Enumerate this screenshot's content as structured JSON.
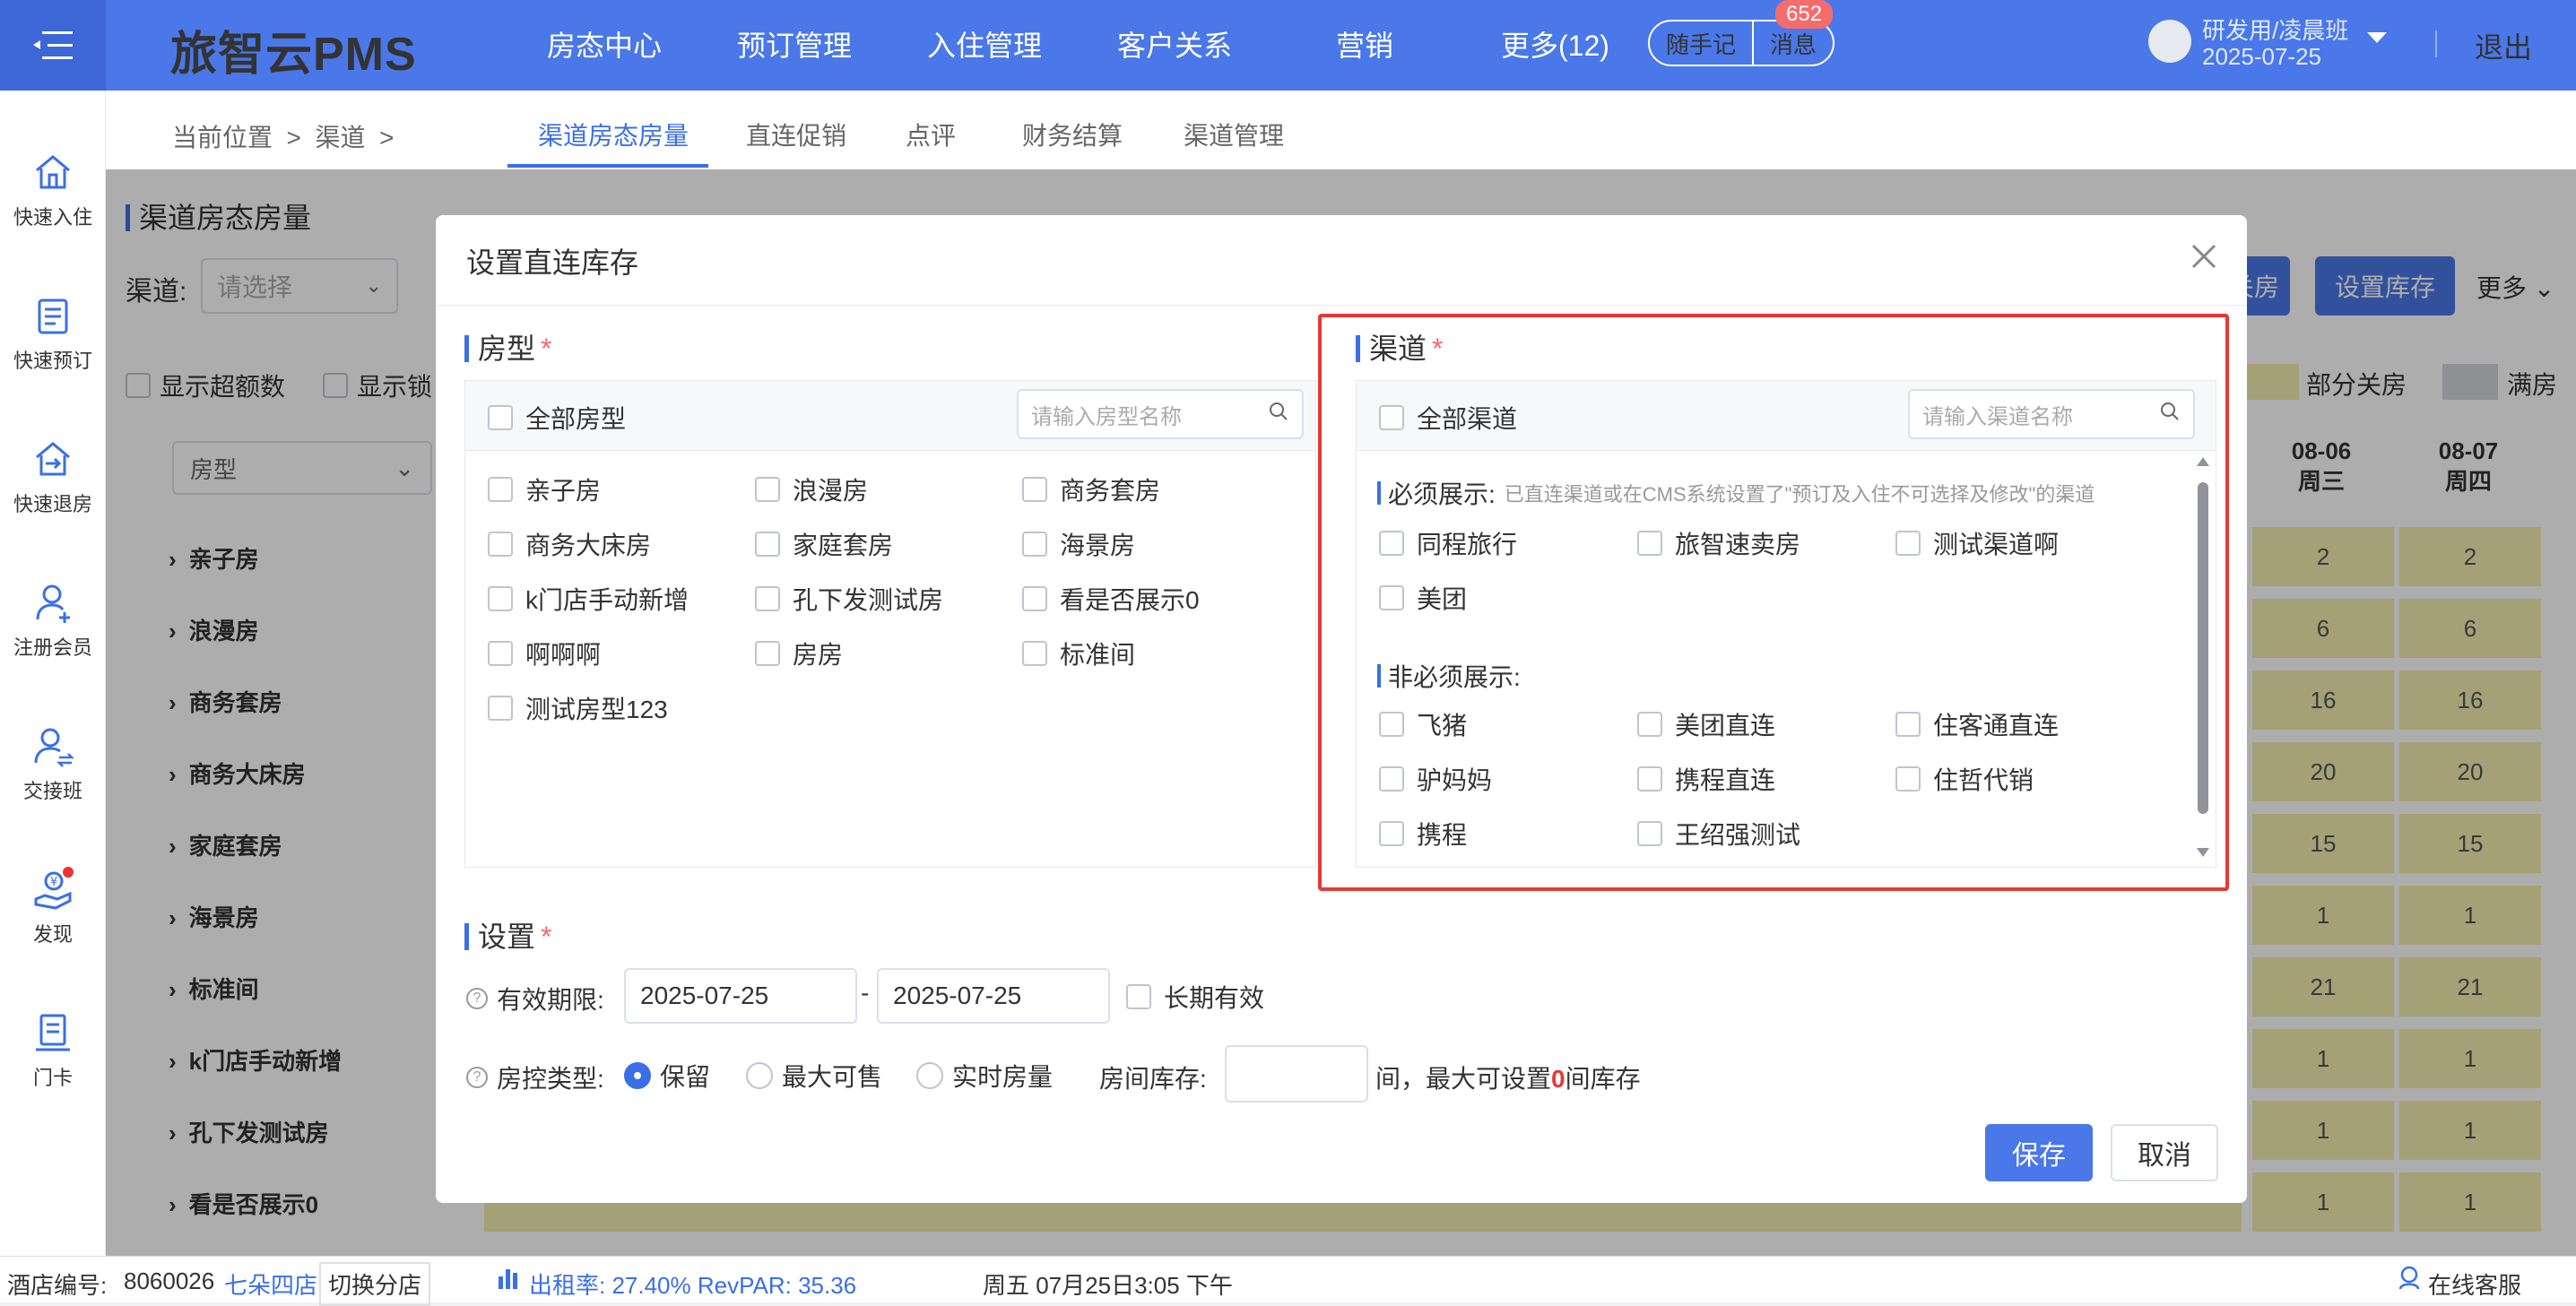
{
  "topbar": {
    "brand": "旅智云PMS",
    "nav": [
      "房态中心",
      "预订管理",
      "入住管理",
      "客户关系",
      "营销",
      "更多(12)"
    ],
    "quick_note": "随手记",
    "messages": "消息",
    "message_count": "652",
    "user_name": "研发用/凌晨班",
    "user_date": "2025-07-25",
    "logout": "退出"
  },
  "sidebar": [
    {
      "label": "快速入住",
      "icon": "home-icon"
    },
    {
      "label": "快速预订",
      "icon": "booking-icon"
    },
    {
      "label": "快速退房",
      "icon": "checkout-icon"
    },
    {
      "label": "注册会员",
      "icon": "add-member-icon"
    },
    {
      "label": "交接班",
      "icon": "shift-handover-icon"
    },
    {
      "label": "发现",
      "icon": "discover-icon"
    },
    {
      "label": "门卡",
      "icon": "door-card-icon"
    }
  ],
  "breadcrumb": "当前位置  >  渠道  >",
  "tabs": [
    "渠道房态房量",
    "直连促销",
    "点评",
    "财务结算",
    "渠道管理"
  ],
  "page": {
    "title": "渠道房态房量",
    "channel_label": "渠道:",
    "channel_placeholder": "请选择",
    "show_over": "显示超额数",
    "show_lock": "显示锁",
    "roomtype_placeholder": "房型",
    "btn_partial": "关房",
    "btn_set_stock": "设置库存",
    "more": "更多",
    "legend_partial": "部分关房",
    "legend_full": "满房",
    "colors": {
      "cell": "#f2eeb0",
      "legend_full": "#d3d5d9",
      "accent": "#4a78e8"
    },
    "dates": [
      {
        "date": "08-06",
        "weekday": "周三"
      },
      {
        "date": "08-07",
        "weekday": "周四"
      }
    ],
    "rows": [
      {
        "name": "亲子房",
        "v1": "2",
        "v2": "2"
      },
      {
        "name": "浪漫房",
        "v1": "6",
        "v2": "6"
      },
      {
        "name": "商务套房",
        "v1": "16",
        "v2": "16"
      },
      {
        "name": "商务大床房",
        "v1": "20",
        "v2": "20"
      },
      {
        "name": "家庭套房",
        "v1": "15",
        "v2": "15"
      },
      {
        "name": "海景房",
        "v1": "1",
        "v2": "1"
      },
      {
        "name": "标准间",
        "v1": "21",
        "v2": "21"
      },
      {
        "name": "k门店手动新增",
        "v1": "1",
        "v2": "1"
      },
      {
        "name": "孔下发测试房",
        "v1": "1",
        "v2": "1"
      },
      {
        "name": "看是否展示0",
        "v1": "1",
        "v2": "1"
      }
    ]
  },
  "modal": {
    "title": "设置直连库存",
    "roomtype_section": "房型",
    "all_roomtypes": "全部房型",
    "roomtype_search_placeholder": "请输入房型名称",
    "roomtypes": [
      "亲子房",
      "浪漫房",
      "商务套房",
      "商务大床房",
      "家庭套房",
      "海景房",
      "k门店手动新增",
      "孔下发测试房",
      "看是否展示0",
      "啊啊啊",
      "房房",
      "标准间",
      "测试房型123"
    ],
    "channel_section": "渠道",
    "all_channels": "全部渠道",
    "channel_search_placeholder": "请输入渠道名称",
    "required_label": "必须展示:",
    "required_note": "已直连渠道或在CMS系统设置了\"预订及入住不可选择及修改\"的渠道",
    "required_channels": [
      "同程旅行",
      "旅智速卖房",
      "测试渠道啊",
      "美团"
    ],
    "optional_label": "非必须展示:",
    "optional_channels": [
      "飞猪",
      "美团直连",
      "住客通直连",
      "驴妈妈",
      "携程直连",
      "住哲代销",
      "携程",
      "王绍强测试"
    ],
    "settings_section": "设置",
    "validity_label": "有效期限:",
    "date_start": "2025-07-25",
    "date_sep": "-",
    "date_end": "2025-07-25",
    "long_term": "长期有效",
    "control_label": "房控类型:",
    "control_options": [
      "保留",
      "最大可售",
      "实时房量"
    ],
    "control_selected": "保留",
    "stock_label": "房间库存:",
    "stock_suffix_a": "间，最大可设置",
    "stock_max": "0",
    "stock_suffix_b": "间库存",
    "save": "保存",
    "cancel": "取消"
  },
  "statusbar": {
    "hotel_label": "酒店编号:",
    "hotel_no": "8060026",
    "hotel_name": "七朵四店",
    "switch_branch": "切换分店",
    "occupancy": "出租率: 27.40% RevPAR: 35.36",
    "datetime": "周五 07月25日3:05 下午",
    "online_service": "在线客服"
  }
}
